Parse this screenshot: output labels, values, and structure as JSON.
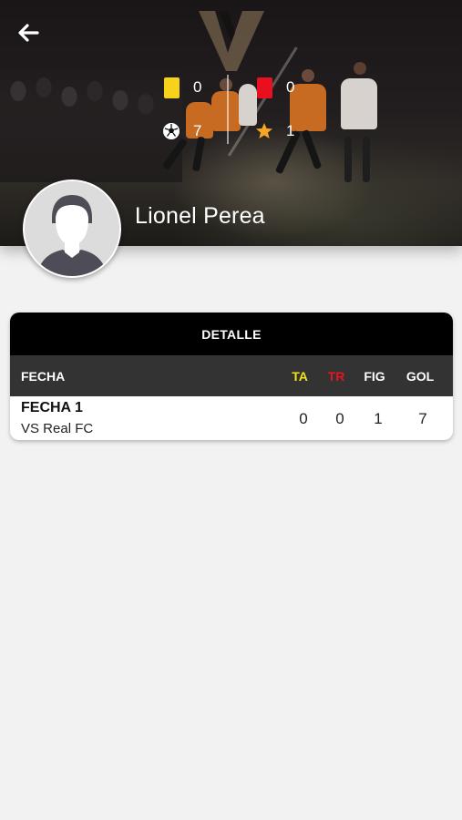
{
  "header": {
    "back_icon": "arrow-left-icon",
    "logo_icon": "team-logo-watermark",
    "player_name": "Lionel Perea",
    "stats": {
      "yellow_cards": "0",
      "red_cards": "0",
      "goals": "7",
      "mvp": "1"
    },
    "colors": {
      "yellow_card": "#f6d21a",
      "red_card": "#e8101e",
      "star": "#f5a623"
    }
  },
  "detail": {
    "title": "DETALLE",
    "columns": {
      "fecha": "FECHA",
      "ta": "TA",
      "tr": "TR",
      "fig": "FIG",
      "gol": "GOL"
    },
    "rows": [
      {
        "fecha": "FECHA 1",
        "rival": "VS Real FC",
        "ta": "0",
        "tr": "0",
        "fig": "1",
        "gol": "7"
      }
    ],
    "colors": {
      "ta": "#f2e31a",
      "tr": "#e8141e"
    }
  }
}
